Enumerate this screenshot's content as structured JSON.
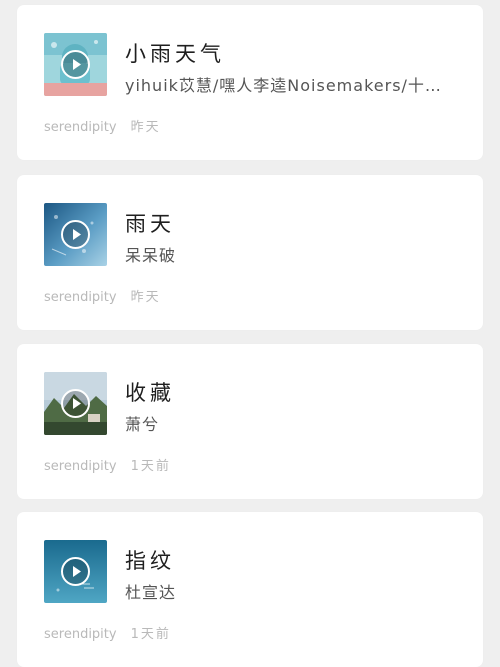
{
  "songs": [
    {
      "title": "小雨天气",
      "artist": "yihuik苡慧/嘿人李逵Noisemakers/十…",
      "source": "serendipity",
      "time": "昨天",
      "cover_icon": "play-circle-icon",
      "cover_colors": [
        "#7fc7d4",
        "#e7a3a0"
      ]
    },
    {
      "title": "雨天",
      "artist": "呆呆破",
      "source": "serendipity",
      "time": "昨天",
      "cover_icon": "play-circle-icon",
      "cover_colors": [
        "#1f5f8f",
        "#8ec1dc"
      ]
    },
    {
      "title": "收藏",
      "artist": "萧兮",
      "source": "serendipity",
      "time": "1天前",
      "cover_icon": "play-circle-icon",
      "cover_colors": [
        "#a9c3d4",
        "#3f5a36"
      ]
    },
    {
      "title": "指纹",
      "artist": "杜宣达",
      "source": "serendipity",
      "time": "1天前",
      "cover_icon": "play-circle-icon",
      "cover_colors": [
        "#1d6f93",
        "#4fa0be"
      ]
    }
  ]
}
